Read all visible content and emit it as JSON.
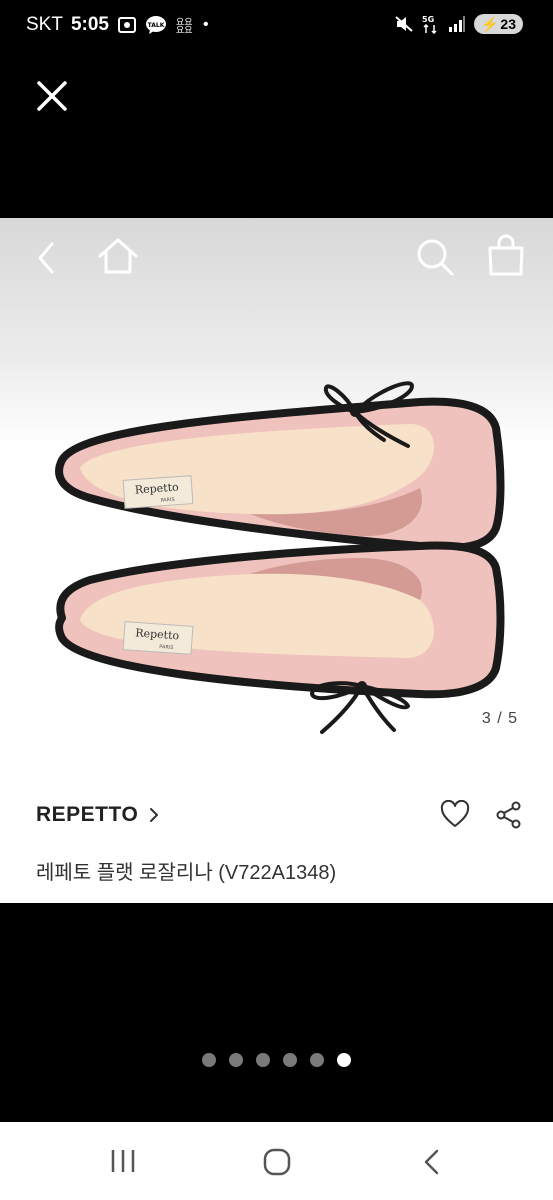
{
  "status": {
    "carrier": "SKT",
    "time": "5:05",
    "network": "5G",
    "battery": "23",
    "dot": "•",
    "chat_label": "TALK"
  },
  "icons": {
    "close": "close-icon",
    "back": "chevron-left-icon",
    "home": "home-icon",
    "search": "search-icon",
    "bag": "shopping-bag-icon",
    "favorite": "heart-icon",
    "share": "share-icon",
    "brand_arrow": "chevron-right-icon"
  },
  "product": {
    "image_index": "3 / 5",
    "brand": "REPETTO",
    "title": "레페토 플랫 로잘리나 (V722A1348)",
    "insole_logo": "Repetto",
    "insole_sub": "PARIS"
  },
  "pagination": {
    "total": 6,
    "active_index": 5
  },
  "colors": {
    "shoe_pink": "#f0c2bd",
    "piping": "#1a1a1a",
    "background": "#000000"
  }
}
